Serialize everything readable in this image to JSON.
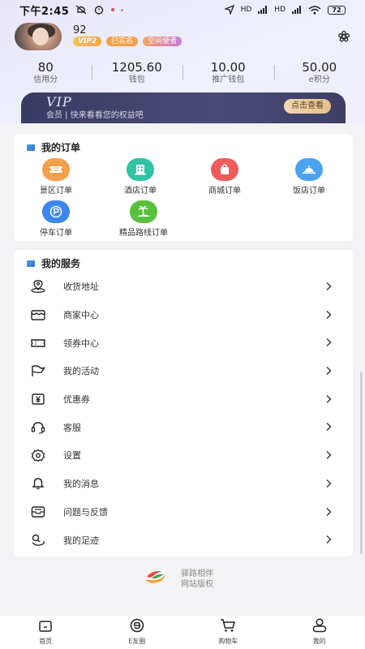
{
  "status_bar": {
    "time": "下午2:45",
    "signal_label_1": "HD",
    "signal_label_2": "HD",
    "battery": "72"
  },
  "profile": {
    "username": "92",
    "badges": [
      "VIP2",
      "已实名",
      "空间使者"
    ]
  },
  "stats": [
    {
      "value": "80",
      "label": "信用分"
    },
    {
      "value": "1205.60",
      "label": "钱包"
    },
    {
      "value": "10.00",
      "label": "推广钱包"
    },
    {
      "value": "50.00",
      "label": "e积分"
    }
  ],
  "vip_banner": {
    "title": "VIP",
    "subtitle": "会员 | 快来看看您的权益吧",
    "button": "点击查看"
  },
  "orders": {
    "title": "我的订单",
    "items": [
      {
        "label": "景区订单",
        "icon": "ticket-icon",
        "color": "#f3a04a"
      },
      {
        "label": "酒店订单",
        "icon": "hotel-icon",
        "color": "#2ec4a4"
      },
      {
        "label": "商城订单",
        "icon": "shopping-bag-icon",
        "color": "#ee5b5b"
      },
      {
        "label": "饭店订单",
        "icon": "food-dome-icon",
        "color": "#4ba3ef"
      },
      {
        "label": "停车订单",
        "icon": "parking-icon",
        "color": "#3d86ee"
      },
      {
        "label": "精品路线订单",
        "icon": "palm-island-icon",
        "color": "#58c03c"
      }
    ]
  },
  "services": {
    "title": "我的服务",
    "items": [
      {
        "label": "收货地址",
        "icon": "location-pin-icon"
      },
      {
        "label": "商家中心",
        "icon": "store-icon"
      },
      {
        "label": "领券中心",
        "icon": "coupon-ticket-icon"
      },
      {
        "label": "我的活动",
        "icon": "flag-icon"
      },
      {
        "label": "优惠券",
        "icon": "yen-coupon-icon"
      },
      {
        "label": "客服",
        "icon": "headset-icon"
      },
      {
        "label": "设置",
        "icon": "gear-icon"
      },
      {
        "label": "我的消息",
        "icon": "bell-icon"
      },
      {
        "label": "问题与反馈",
        "icon": "feedback-icon"
      },
      {
        "label": "我的足迹",
        "icon": "footprint-icon"
      }
    ]
  },
  "footer": {
    "line1": "驿路相伴",
    "line2": "网站版权"
  },
  "tabbar": [
    {
      "label": "首页",
      "icon": "home-icon"
    },
    {
      "label": "E友圈",
      "icon": "e-circle-icon"
    },
    {
      "label": "购物车",
      "icon": "cart-icon"
    },
    {
      "label": "我的",
      "icon": "profile-icon"
    }
  ],
  "colors": {
    "accent_blue": "#2f6fd0",
    "vip_dark": "#3a3b62",
    "vip_gold": "#e4c08b"
  }
}
